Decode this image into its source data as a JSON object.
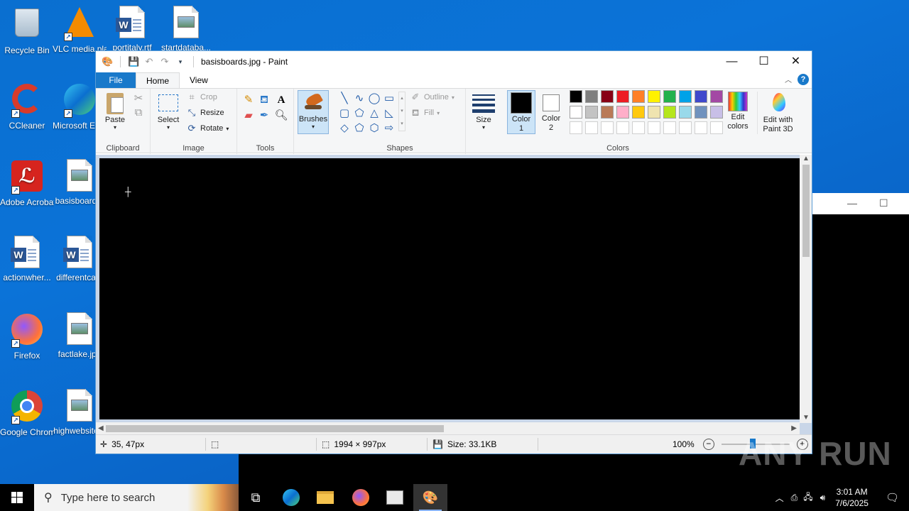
{
  "desktop": {
    "icons": [
      {
        "label": "Recycle Bin",
        "type": "recycle"
      },
      {
        "label": "VLC media player",
        "type": "vlc"
      },
      {
        "label": "portitaly.rtf",
        "type": "word"
      },
      {
        "label": "startdataba...",
        "type": "image"
      },
      {
        "label": "CCleaner",
        "type": "ccleaner"
      },
      {
        "label": "Microsoft Edge",
        "type": "edge"
      },
      {
        "label": "Adobe Acrobat",
        "type": "acrobat"
      },
      {
        "label": "basisboard...",
        "type": "image"
      },
      {
        "label": "actionwher...",
        "type": "word"
      },
      {
        "label": "differentca...",
        "type": "word"
      },
      {
        "label": "Firefox",
        "type": "firefox"
      },
      {
        "label": "factlake.jpg",
        "type": "image"
      },
      {
        "label": "Google Chrome",
        "type": "chrome"
      },
      {
        "label": "highwebsite...",
        "type": "image"
      }
    ]
  },
  "paint": {
    "title": "basisboards.jpg - Paint",
    "tabs": [
      "File",
      "Home",
      "View"
    ],
    "clipboard": {
      "paste": "Paste",
      "label": "Clipboard"
    },
    "image": {
      "select": "Select",
      "crop": "Crop",
      "resize": "Resize",
      "rotate": "Rotate",
      "label": "Image"
    },
    "tools": {
      "label": "Tools"
    },
    "brushes": "Brushes",
    "shapes": {
      "outline": "Outline",
      "fill": "Fill",
      "label": "Shapes"
    },
    "size": "Size",
    "color1": "Color 1",
    "color2": "Color 2",
    "colors_label": "Colors",
    "edit_colors": "Edit colors",
    "edit_paint3d": "Edit with Paint 3D",
    "palette_row1": [
      "#000000",
      "#7f7f7f",
      "#880015",
      "#ed1c24",
      "#ff7f27",
      "#fff200",
      "#22b14c",
      "#00a2e8",
      "#3f48cc",
      "#a349a4"
    ],
    "palette_row2": [
      "#ffffff",
      "#c3c3c3",
      "#b97a57",
      "#ffaec9",
      "#ffc90e",
      "#efe4b0",
      "#b5e61d",
      "#99d9ea",
      "#7092be",
      "#c8bfe7"
    ],
    "status": {
      "cursor": "35, 47px",
      "dimensions": "1994 × 997px",
      "size": "Size: 33.1KB",
      "zoom": "100%"
    }
  },
  "taskbar": {
    "search_placeholder": "Type here to search",
    "time": "3:01 AM",
    "date": "7/6/2025"
  },
  "watermark": "ANY RUN"
}
